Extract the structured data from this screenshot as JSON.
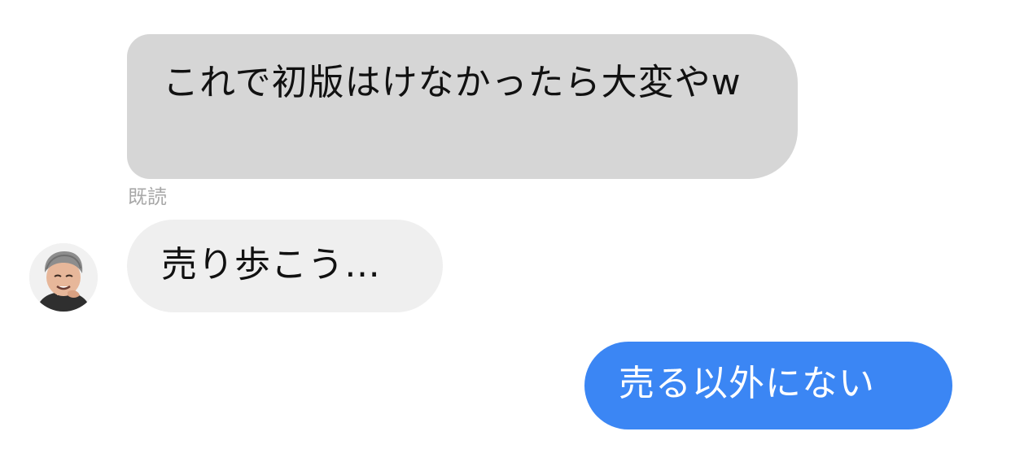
{
  "conversation": {
    "messages": [
      {
        "sender": "self",
        "text": "これで初版はけなかったら大変やw"
      },
      {
        "sender": "other",
        "text": "売り歩こう…"
      },
      {
        "sender": "self",
        "text": "売る以外にない"
      }
    ],
    "read_receipt": "既読"
  },
  "colors": {
    "outgoing_bubble_gray": "#d6d6d6",
    "incoming_bubble": "#efefef",
    "outgoing_bubble_blue": "#3b86f4",
    "read_label": "#a8a8a8"
  },
  "icons": {
    "avatar": "person-avatar-photo"
  }
}
